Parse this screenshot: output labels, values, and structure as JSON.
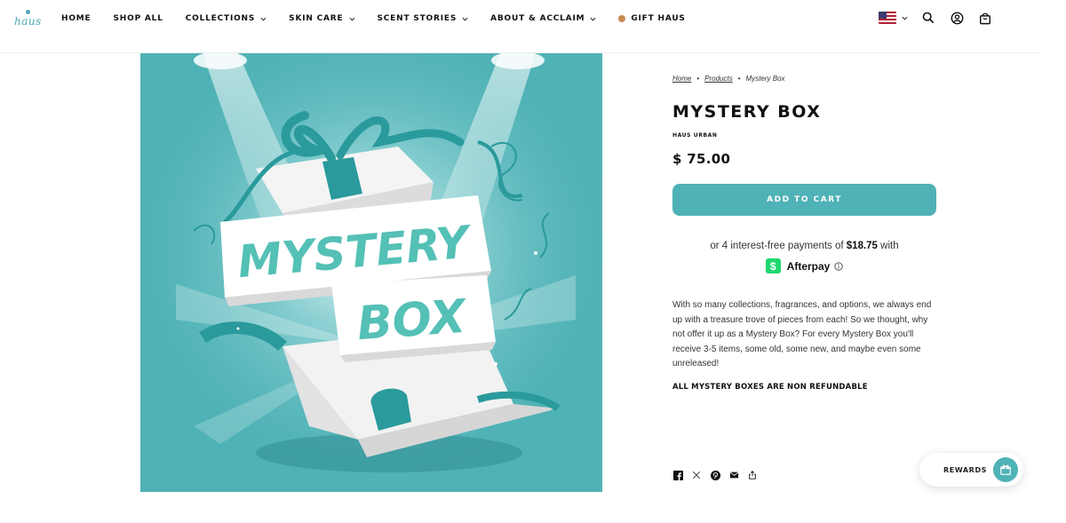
{
  "brand": {
    "logo_text": "haus"
  },
  "nav": {
    "items": [
      {
        "label": "HOME",
        "has_dropdown": false
      },
      {
        "label": "SHOP ALL",
        "has_dropdown": false
      },
      {
        "label": "COLLECTIONS",
        "has_dropdown": true
      },
      {
        "label": "SKIN CARE",
        "has_dropdown": true
      },
      {
        "label": "SCENT STORIES",
        "has_dropdown": true
      },
      {
        "label": "ABOUT & ACCLAIM",
        "has_dropdown": true
      },
      {
        "label": "GIFT HAUS",
        "has_dropdown": false
      }
    ]
  },
  "header_icons": [
    "us-flag-icon",
    "search-icon",
    "account-icon",
    "cart-icon"
  ],
  "breadcrumb": {
    "home": "Home",
    "products": "Products",
    "current": "Mystery Box"
  },
  "product": {
    "title": "MYSTERY BOX",
    "vendor": "HAUS URBAN",
    "price": "$ 75.00",
    "add_to_cart": "ADD TO CART",
    "image_text_line1": "MYSTERY",
    "image_text_line2": "BOX"
  },
  "afterpay": {
    "text_prefix": "or 4 interest-free payments of",
    "amount": "$18.75",
    "text_suffix": "with",
    "brand": "Afterpay",
    "logo_glyph": "$"
  },
  "description": "With so many collections, fragrances, and options, we always end up with a treasure trove of pieces from each! So we thought, why not offer it up as a Mystery Box? For every Mystery Box you'll receive 3-5 items, some old, some new, and maybe even some unreleased!",
  "non_refundable": "ALL MYSTERY BOXES ARE NON REFUNDABLE",
  "share_icons": [
    "facebook-icon",
    "x-icon",
    "pinterest-icon",
    "email-icon",
    "share-icon"
  ],
  "rewards": {
    "label": "REWARDS"
  },
  "colors": {
    "accent": "#4fb2b6",
    "afterpay": "#1ed66e",
    "text": "#111111"
  }
}
